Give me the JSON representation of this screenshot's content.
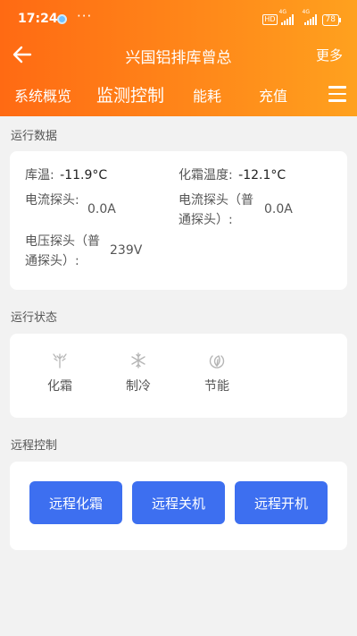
{
  "status_bar": {
    "time": "17:24",
    "more": "···",
    "hd": "HD",
    "net1": "4G",
    "net2": "4G",
    "battery": "78"
  },
  "header": {
    "title": "兴国铝排库曾总",
    "more_label": "更多"
  },
  "tabs": [
    {
      "label": "系统概览",
      "active": false
    },
    {
      "label": "监测控制",
      "active": true
    },
    {
      "label": "能耗",
      "active": false
    },
    {
      "label": "充值",
      "active": false
    }
  ],
  "run_data": {
    "section_title": "运行数据",
    "items": [
      {
        "label": "库温:",
        "value": "-11.9°C"
      },
      {
        "label": "化霜温度:",
        "value": "-12.1°C"
      },
      {
        "label": "电流探头:",
        "value": "0.0A"
      },
      {
        "label": "电流探头（普",
        "label2": "通探头）:",
        "value": "0.0A"
      },
      {
        "label": "电压探头（普",
        "label2": "通探头）:",
        "value": "239V"
      }
    ]
  },
  "run_state": {
    "section_title": "运行状态",
    "items": [
      {
        "label": "化霜",
        "icon": "defrost-icon"
      },
      {
        "label": "制冷",
        "icon": "snowflake-icon"
      },
      {
        "label": "节能",
        "icon": "leaf-icon"
      }
    ]
  },
  "remote": {
    "section_title": "远程控制",
    "buttons": [
      "远程化霜",
      "远程关机",
      "远程开机"
    ]
  },
  "colors": {
    "header_start": "#ff6a13",
    "header_end": "#ffa11e",
    "button": "#3d6ff0",
    "background": "#f2f2f2"
  }
}
